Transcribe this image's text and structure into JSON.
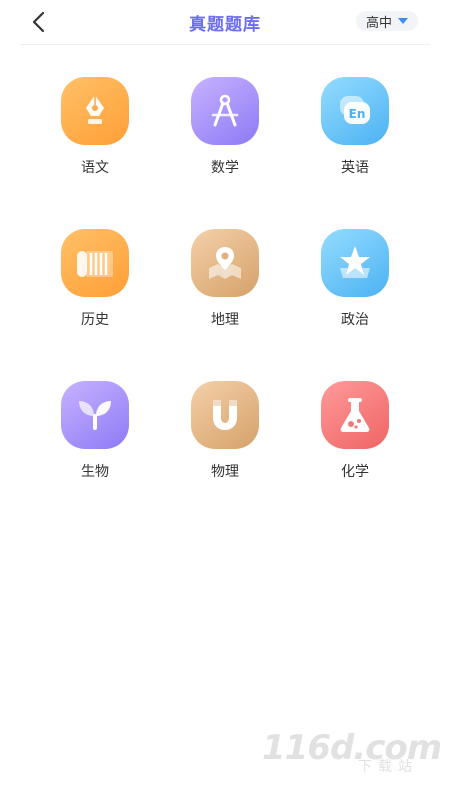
{
  "header": {
    "back_icon": "chevron-left-icon",
    "title": "真题题库",
    "level_select": {
      "value": "高中",
      "icon": "caret-down-icon",
      "caret_color": "#3f8cf5"
    },
    "title_color": "#6d6df2"
  },
  "subjects": [
    {
      "label": "语文",
      "icon": "fountain-pen-icon",
      "gradient": "orange"
    },
    {
      "label": "数学",
      "icon": "compass-icon",
      "gradient": "purple"
    },
    {
      "label": "英语",
      "icon": "en-speech-bubble-icon",
      "gradient": "blue",
      "icon_text": "En"
    },
    {
      "label": "历史",
      "icon": "scroll-icon",
      "gradient": "orange"
    },
    {
      "label": "地理",
      "icon": "map-pin-icon",
      "gradient": "tan"
    },
    {
      "label": "政治",
      "icon": "star-badge-icon",
      "gradient": "blue"
    },
    {
      "label": "生物",
      "icon": "sprout-icon",
      "gradient": "purple"
    },
    {
      "label": "物理",
      "icon": "magnet-icon",
      "gradient": "tan"
    },
    {
      "label": "化学",
      "icon": "flask-icon",
      "gradient": "red"
    }
  ],
  "watermark": {
    "main": "116d.com",
    "sub": "下载站"
  }
}
